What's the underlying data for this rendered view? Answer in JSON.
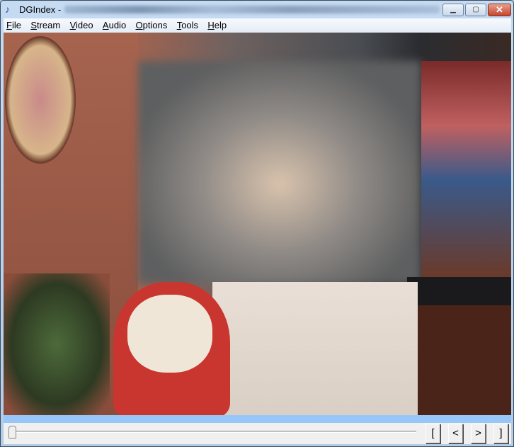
{
  "titlebar": {
    "title": "DGIndex - ",
    "minimize": "▁",
    "maximize": "▢",
    "close": "✕"
  },
  "menu": [
    {
      "first": "F",
      "rest": "ile"
    },
    {
      "first": "S",
      "rest": "tream"
    },
    {
      "first": "V",
      "rest": "ideo"
    },
    {
      "first": "A",
      "rest": "udio"
    },
    {
      "first": "O",
      "rest": "ptions"
    },
    {
      "first": "T",
      "rest": "ools"
    },
    {
      "first": "H",
      "rest": "elp"
    }
  ],
  "controls": {
    "mark_in": "[",
    "prev": "<",
    "next": ">",
    "mark_out": "]",
    "slider_position": 0
  },
  "colors": {
    "progress_strip": "#99c6f8",
    "close_button": "#c6452e"
  }
}
